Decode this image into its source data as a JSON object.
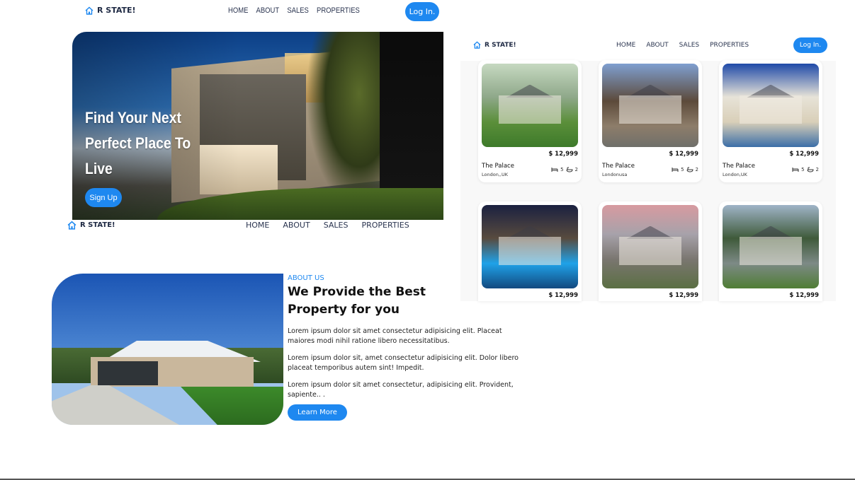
{
  "brand": "R STATE!",
  "nav": [
    "HOME",
    "ABOUT",
    "SALES",
    "PROPERTIES"
  ],
  "login_label": "Log In.",
  "hero": {
    "title": "Find Your Next Perfect Place To Live",
    "signup_label": "Sign Up"
  },
  "about": {
    "label": "ABOUT US",
    "title": "We Provide the Best Property for you",
    "paragraphs": [
      "Lorem ipsum dolor sit amet consectetur adipisicing elit. Placeat maiores modi nihil ratione libero necessitatibus.",
      "Lorem ipsum dolor sit, amet consectetur adipisicing elit. Dolor libero placeat temporibus autem sint! Impedit.",
      "Lorem ipsum dolor sit amet consectetur, adipisicing elit. Provident, sapiente.. ."
    ],
    "button_label": "Learn More"
  },
  "listings": [
    {
      "price": "$ 12,999",
      "name": "The Palace",
      "location": "London,,UK",
      "beds": "5",
      "baths": "2"
    },
    {
      "price": "$ 12,999",
      "name": "The Palace",
      "location": "Londonusa",
      "beds": "5",
      "baths": "2"
    },
    {
      "price": "$ 12,999",
      "name": "The Palace",
      "location": "London,UK",
      "beds": "5",
      "baths": "2"
    },
    {
      "price": "$ 12,999"
    },
    {
      "price": "$ 12,999"
    },
    {
      "price": "$ 12,999"
    }
  ],
  "colors": {
    "accent": "#1e88f0",
    "text_dark": "#1f2a44"
  },
  "icons": [
    "home-icon",
    "bed-icon",
    "bath-icon"
  ]
}
